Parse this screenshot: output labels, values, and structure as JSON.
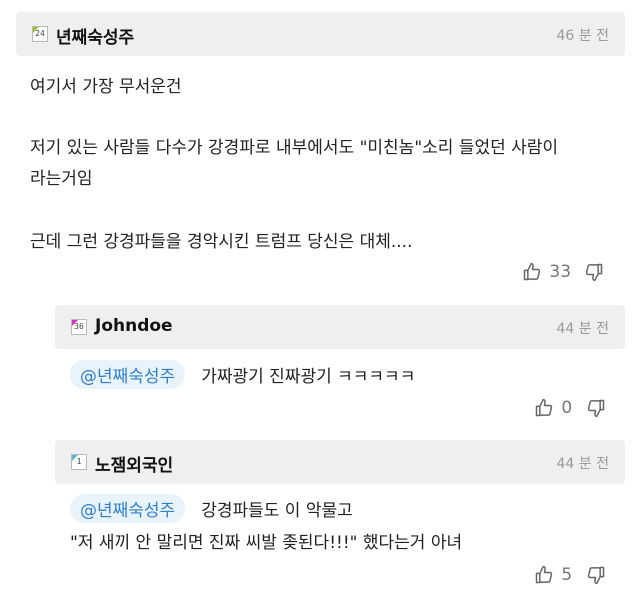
{
  "comment": {
    "level": "24",
    "level_color": "#9ec83a",
    "author": "년째숙성주",
    "time": "46 분 전",
    "lines": [
      "여기서 가장 무서운건",
      "저기 있는 사람들 다수가 강경파로 내부에서도 \"미친놈\"소리 들었던 사람이",
      "라는거임",
      "근데 그런 강경파들을 경악시킨 트럼프 당신은 대체...."
    ],
    "likes": "33"
  },
  "replies": [
    {
      "level": "36",
      "level_color": "#d236c9",
      "author": "Johndoe",
      "time": "44 분 전",
      "mention": "@년째숙성주",
      "lines": [
        "가짜광기 진짜광기 ㅋㅋㅋㅋㅋ"
      ],
      "likes": "0"
    },
    {
      "level": "1",
      "level_color": "#56b7cf",
      "author": "노잼외국인",
      "time": "44 분 전",
      "mention": "@년째숙성주",
      "lines": [
        "강경파들도 이 악물고",
        "\"저 새끼 안 말리면 진짜 씨발 좆된다!!!\" 했다는거 아녀"
      ],
      "likes": "5"
    }
  ]
}
